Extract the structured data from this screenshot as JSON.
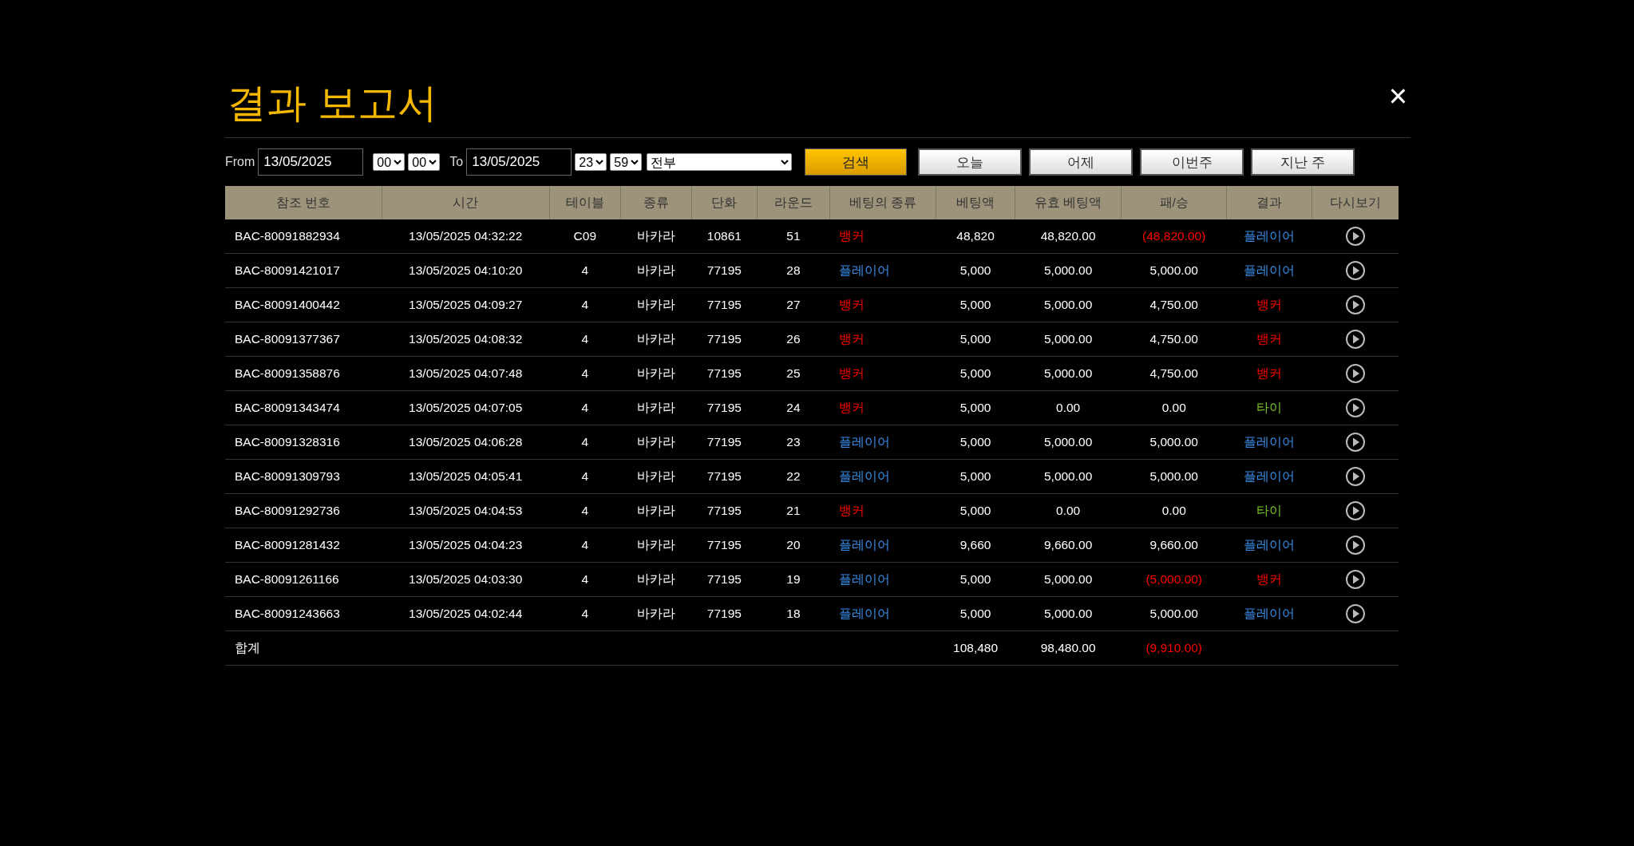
{
  "title": "결과 보고서",
  "close": "×",
  "filters": {
    "from_label": "From",
    "from_date": "13/05/2025",
    "from_hour": "00",
    "from_minute": "00",
    "to_label": "To",
    "to_date": "13/05/2025",
    "to_hour": "23",
    "to_minute": "59",
    "game": "전부",
    "search_button": "검색",
    "quick_buttons": [
      "오늘",
      "어제",
      "이번주",
      "지난 주"
    ]
  },
  "table": {
    "columns": [
      "참조 번호",
      "시간",
      "테이블",
      "종류",
      "단화",
      "라운드",
      "베팅의 종류",
      "베팅액",
      "유효 베팅액",
      "패/승",
      "결과",
      "다시보기"
    ],
    "rows": [
      {
        "ref": "BAC-80091882934",
        "time": "13/05/2025 04:32:22",
        "table": "C09",
        "game": "바카라",
        "shoe": "10861",
        "round": "51",
        "bet_type": {
          "text": "뱅커",
          "color": "#ff0000"
        },
        "bet": "48,820",
        "valid_bet": "48,820.00",
        "win_loss": {
          "text": "(48,820.00)",
          "color": "#ff0000"
        },
        "result": {
          "text": "플레이어",
          "color": "#3b8ee8"
        }
      },
      {
        "ref": "BAC-80091421017",
        "time": "13/05/2025 04:10:20",
        "table": "4",
        "game": "바카라",
        "shoe": "77195",
        "round": "28",
        "bet_type": {
          "text": "플레이어",
          "color": "#3b8ee8"
        },
        "bet": "5,000",
        "valid_bet": "5,000.00",
        "win_loss": {
          "text": "5,000.00",
          "color": "#ffffff"
        },
        "result": {
          "text": "플레이어",
          "color": "#3b8ee8"
        }
      },
      {
        "ref": "BAC-80091400442",
        "time": "13/05/2025 04:09:27",
        "table": "4",
        "game": "바카라",
        "shoe": "77195",
        "round": "27",
        "bet_type": {
          "text": "뱅커",
          "color": "#ff0000"
        },
        "bet": "5,000",
        "valid_bet": "5,000.00",
        "win_loss": {
          "text": "4,750.00",
          "color": "#ffffff"
        },
        "result": {
          "text": "뱅커",
          "color": "#ff0000"
        }
      },
      {
        "ref": "BAC-80091377367",
        "time": "13/05/2025 04:08:32",
        "table": "4",
        "game": "바카라",
        "shoe": "77195",
        "round": "26",
        "bet_type": {
          "text": "뱅커",
          "color": "#ff0000"
        },
        "bet": "5,000",
        "valid_bet": "5,000.00",
        "win_loss": {
          "text": "4,750.00",
          "color": "#ffffff"
        },
        "result": {
          "text": "뱅커",
          "color": "#ff0000"
        }
      },
      {
        "ref": "BAC-80091358876",
        "time": "13/05/2025 04:07:48",
        "table": "4",
        "game": "바카라",
        "shoe": "77195",
        "round": "25",
        "bet_type": {
          "text": "뱅커",
          "color": "#ff0000"
        },
        "bet": "5,000",
        "valid_bet": "5,000.00",
        "win_loss": {
          "text": "4,750.00",
          "color": "#ffffff"
        },
        "result": {
          "text": "뱅커",
          "color": "#ff0000"
        }
      },
      {
        "ref": "BAC-80091343474",
        "time": "13/05/2025 04:07:05",
        "table": "4",
        "game": "바카라",
        "shoe": "77195",
        "round": "24",
        "bet_type": {
          "text": "뱅커",
          "color": "#ff0000"
        },
        "bet": "5,000",
        "valid_bet": "0.00",
        "win_loss": {
          "text": "0.00",
          "color": "#ffffff"
        },
        "result": {
          "text": "타이",
          "color": "#7cc52a"
        }
      },
      {
        "ref": "BAC-80091328316",
        "time": "13/05/2025 04:06:28",
        "table": "4",
        "game": "바카라",
        "shoe": "77195",
        "round": "23",
        "bet_type": {
          "text": "플레이어",
          "color": "#3b8ee8"
        },
        "bet": "5,000",
        "valid_bet": "5,000.00",
        "win_loss": {
          "text": "5,000.00",
          "color": "#ffffff"
        },
        "result": {
          "text": "플레이어",
          "color": "#3b8ee8"
        }
      },
      {
        "ref": "BAC-80091309793",
        "time": "13/05/2025 04:05:41",
        "table": "4",
        "game": "바카라",
        "shoe": "77195",
        "round": "22",
        "bet_type": {
          "text": "플레이어",
          "color": "#3b8ee8"
        },
        "bet": "5,000",
        "valid_bet": "5,000.00",
        "win_loss": {
          "text": "5,000.00",
          "color": "#ffffff"
        },
        "result": {
          "text": "플레이어",
          "color": "#3b8ee8"
        }
      },
      {
        "ref": "BAC-80091292736",
        "time": "13/05/2025 04:04:53",
        "table": "4",
        "game": "바카라",
        "shoe": "77195",
        "round": "21",
        "bet_type": {
          "text": "뱅커",
          "color": "#ff0000"
        },
        "bet": "5,000",
        "valid_bet": "0.00",
        "win_loss": {
          "text": "0.00",
          "color": "#ffffff"
        },
        "result": {
          "text": "타이",
          "color": "#7cc52a"
        }
      },
      {
        "ref": "BAC-80091281432",
        "time": "13/05/2025 04:04:23",
        "table": "4",
        "game": "바카라",
        "shoe": "77195",
        "round": "20",
        "bet_type": {
          "text": "플레이어",
          "color": "#3b8ee8"
        },
        "bet": "9,660",
        "valid_bet": "9,660.00",
        "win_loss": {
          "text": "9,660.00",
          "color": "#ffffff"
        },
        "result": {
          "text": "플레이어",
          "color": "#3b8ee8"
        }
      },
      {
        "ref": "BAC-80091261166",
        "time": "13/05/2025 04:03:30",
        "table": "4",
        "game": "바카라",
        "shoe": "77195",
        "round": "19",
        "bet_type": {
          "text": "플레이어",
          "color": "#3b8ee8"
        },
        "bet": "5,000",
        "valid_bet": "5,000.00",
        "win_loss": {
          "text": "(5,000.00)",
          "color": "#ff0000"
        },
        "result": {
          "text": "뱅커",
          "color": "#ff0000"
        }
      },
      {
        "ref": "BAC-80091243663",
        "time": "13/05/2025 04:02:44",
        "table": "4",
        "game": "바카라",
        "shoe": "77195",
        "round": "18",
        "bet_type": {
          "text": "플레이어",
          "color": "#3b8ee8"
        },
        "bet": "5,000",
        "valid_bet": "5,000.00",
        "win_loss": {
          "text": "5,000.00",
          "color": "#ffffff"
        },
        "result": {
          "text": "플레이어",
          "color": "#3b8ee8"
        }
      }
    ],
    "total": {
      "label": "합계",
      "bet": "108,480",
      "valid_bet": "98,480.00",
      "win_loss": {
        "text": "(9,910.00)",
        "color": "#ff0000"
      }
    }
  }
}
